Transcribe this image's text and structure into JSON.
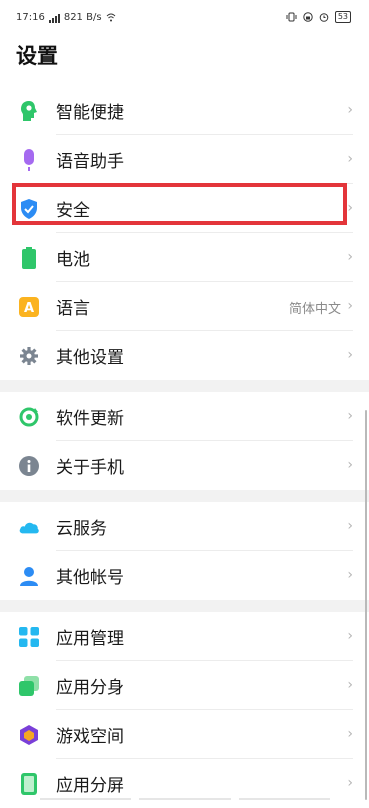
{
  "status": {
    "time": "17:16",
    "speed": "821 B/s",
    "battery": "53",
    "icons": [
      "signal-icon",
      "wifi-icon",
      "vibrate-icon",
      "lock-icon",
      "alarm-icon",
      "battery-icon"
    ]
  },
  "page": {
    "title": "设置"
  },
  "groups": [
    {
      "items": [
        {
          "label": "智能便捷",
          "icon": "smart-brain-icon"
        },
        {
          "label": "语音助手",
          "icon": "microphone-icon"
        },
        {
          "label": "安全",
          "icon": "shield-check-icon",
          "highlighted": true
        },
        {
          "label": "电池",
          "icon": "battery-green-icon"
        },
        {
          "label": "语言",
          "icon": "language-a-icon",
          "value": "简体中文"
        },
        {
          "label": "其他设置",
          "icon": "gear-icon"
        }
      ]
    },
    {
      "items": [
        {
          "label": "软件更新",
          "icon": "update-cycle-icon"
        },
        {
          "label": "关于手机",
          "icon": "info-icon"
        }
      ]
    },
    {
      "items": [
        {
          "label": "云服务",
          "icon": "cloud-icon"
        },
        {
          "label": "其他帐号",
          "icon": "person-icon"
        }
      ]
    },
    {
      "items": [
        {
          "label": "应用管理",
          "icon": "app-grid-icon"
        },
        {
          "label": "应用分身",
          "icon": "app-clone-icon"
        },
        {
          "label": "游戏空间",
          "icon": "game-cube-icon"
        },
        {
          "label": "应用分屏",
          "icon": "split-screen-icon"
        }
      ]
    }
  ],
  "chevron": "›",
  "colors": {
    "highlight": "#e3353a",
    "group_bg": "#f2f2f2"
  }
}
